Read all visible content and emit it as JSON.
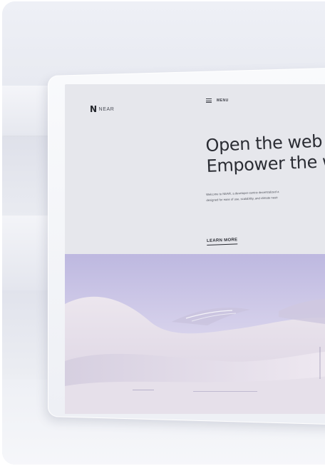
{
  "scene": {
    "background": "studio mockup with a tilted display",
    "accent_color": "#2a2c33",
    "screen_background": "#e6e7ec"
  },
  "website": {
    "logo_mark": "N",
    "logo_text": "NEAR",
    "menu_label": "MENU",
    "headline_line1": "Open the web",
    "headline_line2": "Empower the w",
    "subcopy_line1": "Welcome to NEAR, a developer-centric decentralized a",
    "subcopy_line2": "designed for ease of use, scalability, and climate neutr",
    "cta_label": "LEARN MORE",
    "hero_colors": {
      "sky_top": "#b9b4de",
      "sky_bottom": "#e4dfef",
      "dune_light": "#e9e3ea",
      "dune_shadow": "#c7bfd5"
    }
  }
}
